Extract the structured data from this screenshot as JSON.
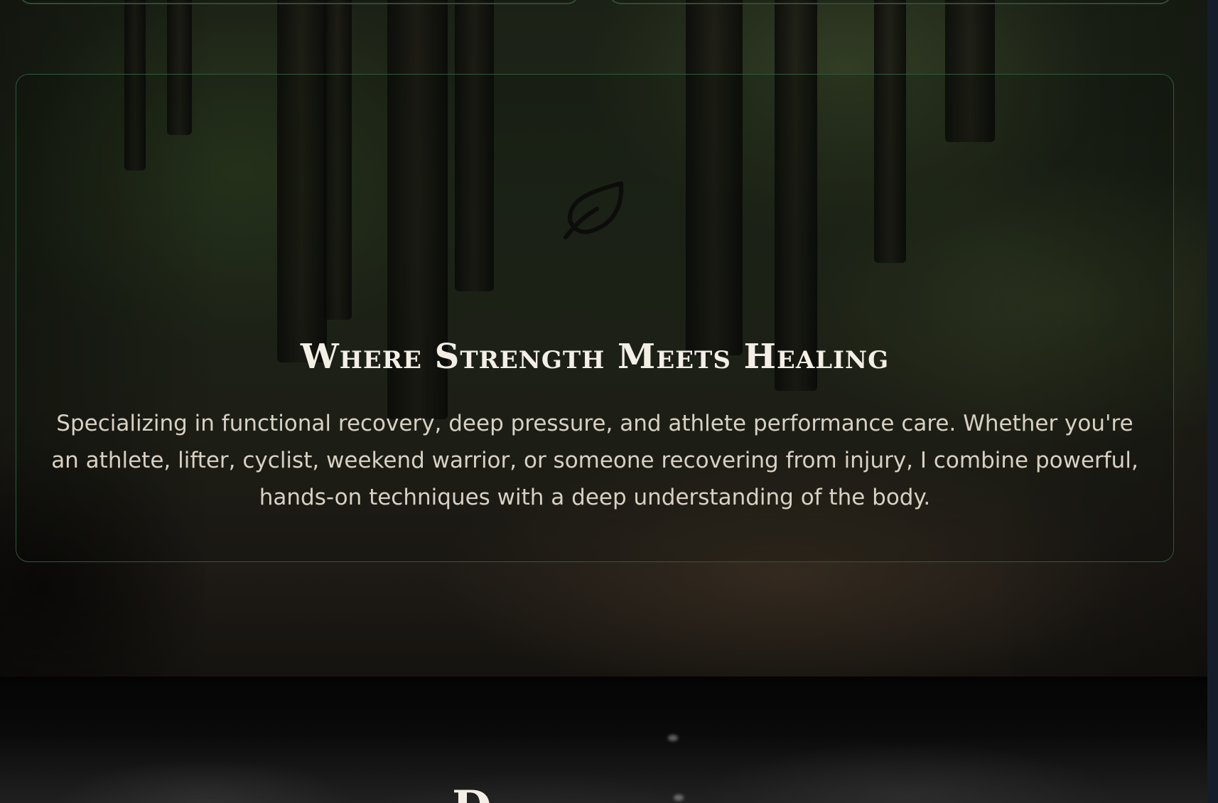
{
  "feature": {
    "icon": "leaf-icon",
    "title": "Where Strength Meets Healing",
    "description": "Specializing in functional recovery, deep pressure, and athlete performance care. Whether you're an athlete, lifter, cyclist, weekend warrior, or someone recovering from injury, I combine powerful, hands-on techniques with a deep understanding of the body."
  },
  "next_section": {
    "heading_partial": "D"
  },
  "colors": {
    "card_border": "#2e5a3a",
    "title_text": "#f3efe6",
    "body_text": "#d8d1c4",
    "page_background": "#050608"
  }
}
